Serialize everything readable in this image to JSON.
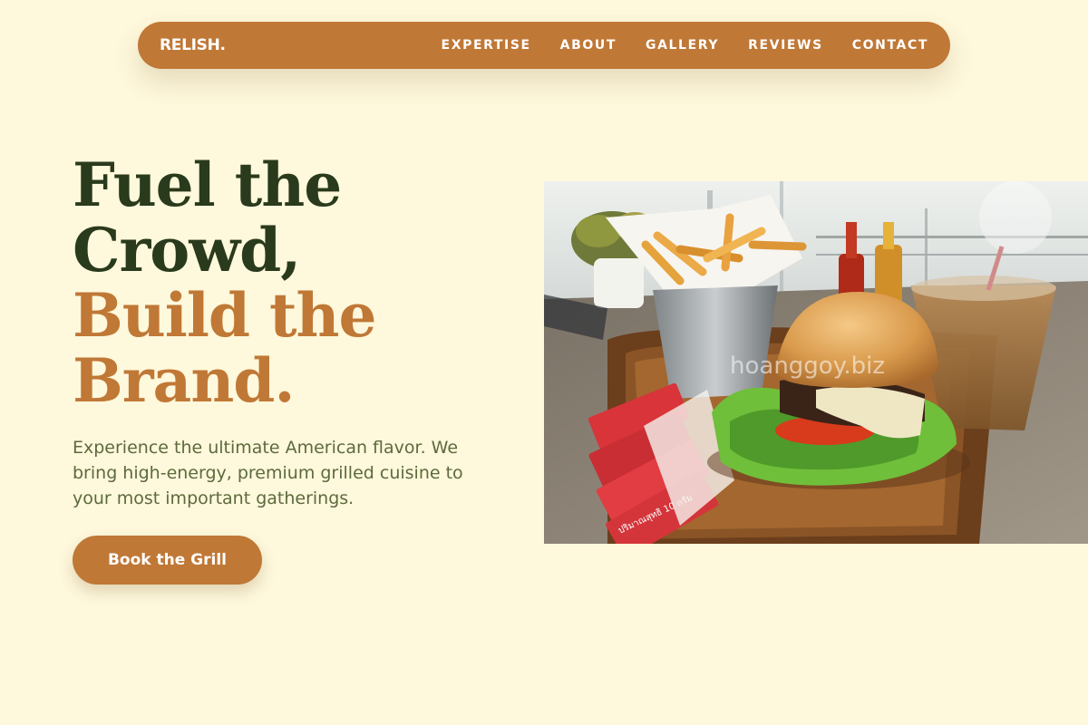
{
  "nav": {
    "logo": "RELISH.",
    "items": [
      {
        "label": "EXPERTISE"
      },
      {
        "label": "ABOUT"
      },
      {
        "label": "GALLERY"
      },
      {
        "label": "REVIEWS"
      },
      {
        "label": "CONTACT"
      }
    ]
  },
  "hero": {
    "headline_line1": "Fuel the",
    "headline_line2": "Crowd,",
    "headline_line3": "Build the",
    "headline_line4": "Brand.",
    "subtext": "Experience the ultimate American flavor. We bring high-energy, premium grilled cuisine to your most important gatherings.",
    "cta_label": "Book the Grill"
  },
  "photo": {
    "watermark": "hoanggoy.biz",
    "sauce_packet_text": "ปริมาณสุทธิ 10 กรัม"
  },
  "colors": {
    "background": "#fef8dc",
    "accent": "#c07836",
    "headline_dark": "#2a3a1c",
    "body_text": "#5d6a3c"
  }
}
